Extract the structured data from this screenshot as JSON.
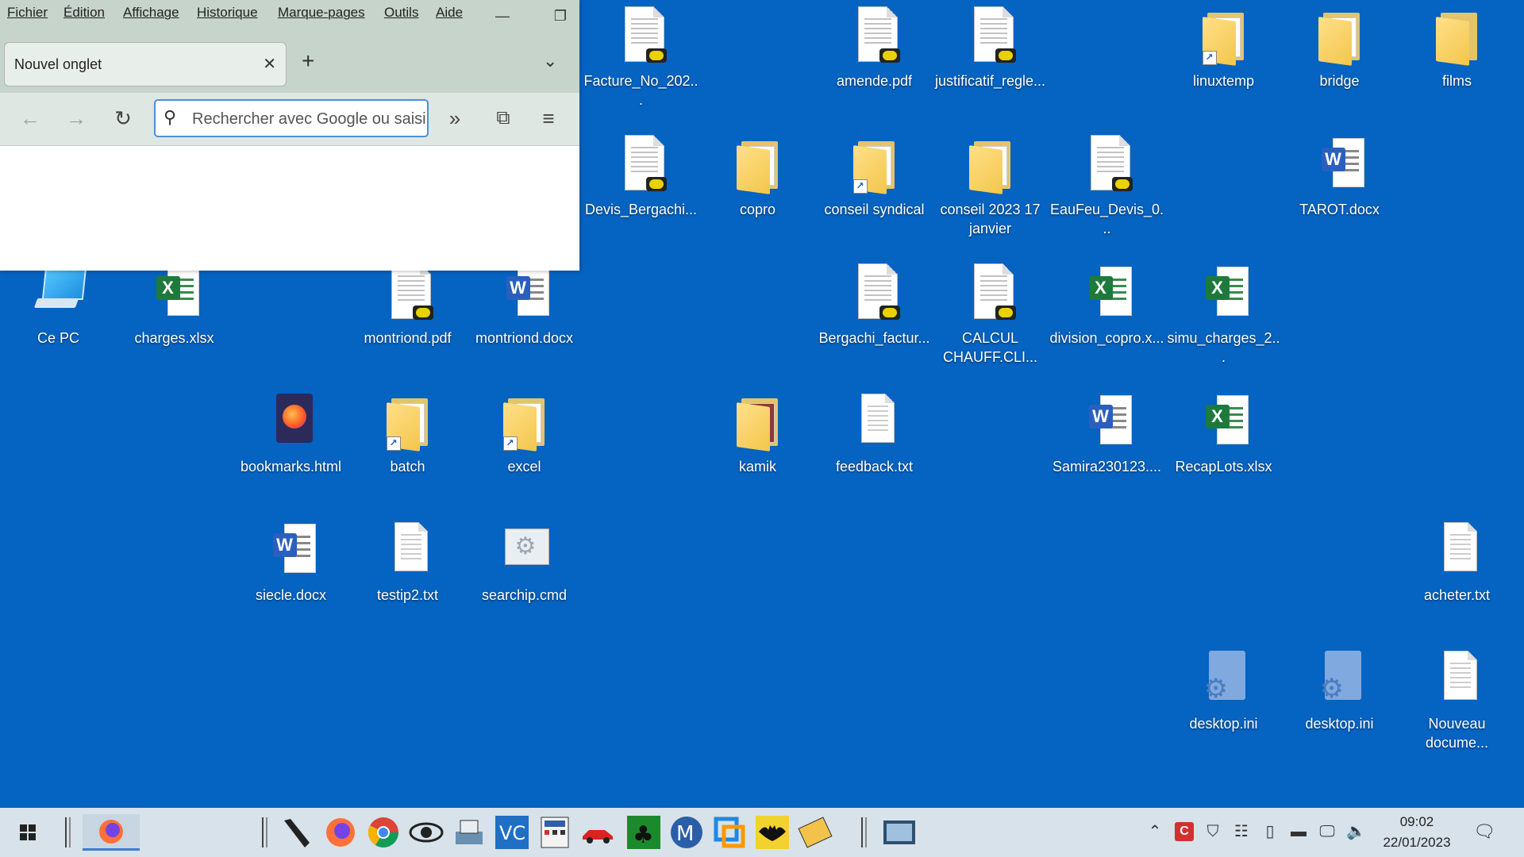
{
  "browser": {
    "menu": [
      "Fichier",
      "Édition",
      "Affichage",
      "Historique",
      "Marque-pages",
      "Outils",
      "Aide"
    ],
    "tab_title": "Nouvel onglet",
    "url_placeholder": "Rechercher avec Google ou saisir une adresse"
  },
  "desktop": {
    "icons": [
      "Facture_No_202...",
      "amende.pdf",
      "justificatif_regle...",
      "linuxtemp",
      "bridge",
      "films",
      "Devis_Bergachi...",
      "copro",
      "conseil syndical",
      "conseil 2023 17 janvier",
      "EauFeu_Devis_0...",
      "TAROT.docx",
      "Ce PC",
      "charges.xlsx",
      "montriond.pdf",
      "montriond.docx",
      "Bergachi_factur...",
      "CALCUL CHAUFF.CLI...",
      "division_copro.x...",
      "simu_charges_2...",
      "bookmarks.html",
      "batch",
      "excel",
      "kamik",
      "feedback.txt",
      "Samira230123....",
      "RecapLots.xlsx",
      "siecle.docx",
      "testip2.txt",
      "searchip.cmd",
      "acheter.txt",
      "desktop.ini",
      "desktop.ini",
      "Nouveau docume..."
    ]
  },
  "taskbar": {
    "time": "09:02",
    "date": "22/01/2023"
  }
}
